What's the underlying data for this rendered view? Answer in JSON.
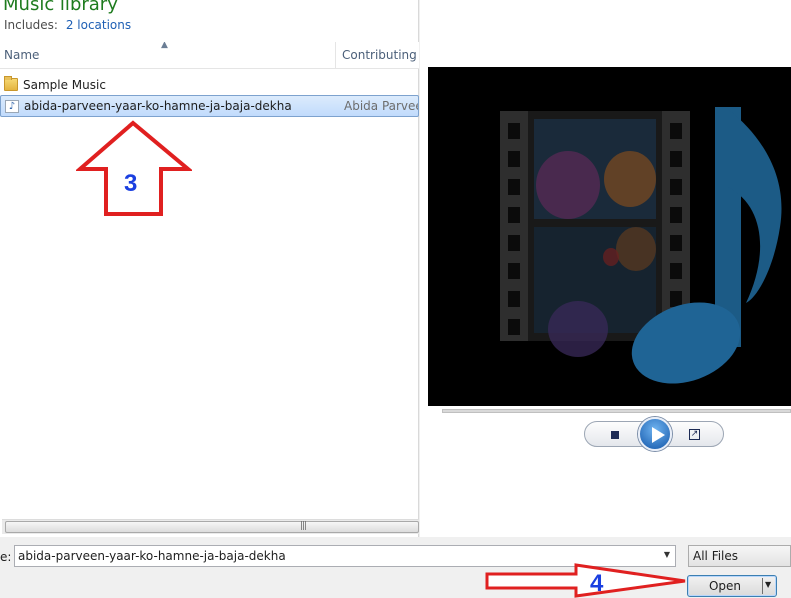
{
  "library": {
    "title": "Music library",
    "includes_label": "Includes:",
    "locations_link": "2 locations"
  },
  "columns": {
    "name": "Name",
    "contributing": "Contributing a"
  },
  "files": [
    {
      "name": "Sample Music",
      "contributing": "",
      "icon": "folder-icon"
    },
    {
      "name": "abida-parveen-yaar-ko-hamne-ja-baja-dekha",
      "contributing": "Abida Parveen",
      "icon": "music-file-icon",
      "selected": true
    }
  ],
  "annotations": {
    "step3": "3",
    "step4": "4",
    "arrow_color": "#e02020"
  },
  "footer": {
    "filename_label": "e:",
    "filename_value": "abida-parveen-yaar-ko-hamne-ja-baja-dekha",
    "filter_value": "All Files",
    "open_label": "Open"
  },
  "colors": {
    "title_green": "#1e7b1e",
    "link_blue": "#1e5fb4",
    "selection": "#c1dbfc",
    "annotation_text": "#1a3fe0"
  }
}
